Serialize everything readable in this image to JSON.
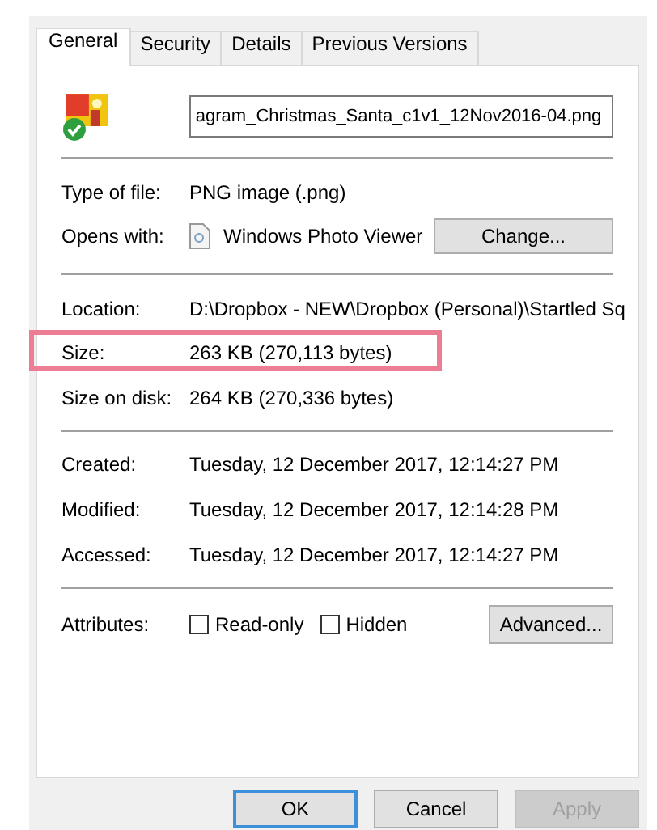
{
  "tabs": [
    {
      "label": "General",
      "selected": true
    },
    {
      "label": "Security",
      "selected": false
    },
    {
      "label": "Details",
      "selected": false
    },
    {
      "label": "Previous Versions",
      "selected": false
    }
  ],
  "file_name": "agram_Christmas_Santa_c1v1_12Nov2016-04.png",
  "type_of_file": {
    "label": "Type of file:",
    "value": "PNG image (.png)"
  },
  "opens_with": {
    "label": "Opens with:",
    "app": "Windows Photo Viewer",
    "button": "Change..."
  },
  "location_rows": [
    {
      "label": "Location:",
      "value": "D:\\Dropbox - NEW\\Dropbox (Personal)\\Startled Sq",
      "highlighted": false
    },
    {
      "label": "Size:",
      "value": "263 KB (270,113 bytes)",
      "highlighted": true
    },
    {
      "label": "Size on disk:",
      "value": "264 KB (270,336 bytes)",
      "highlighted": false
    }
  ],
  "date_rows": [
    {
      "label": "Created:",
      "value": "Tuesday, 12 December 2017, 12:14:27 PM"
    },
    {
      "label": "Modified:",
      "value": "Tuesday, 12 December 2017, 12:14:28 PM"
    },
    {
      "label": "Accessed:",
      "value": "Tuesday, 12 December 2017, 12:14:27 PM"
    }
  ],
  "attributes": {
    "label": "Attributes:",
    "checkboxes": [
      {
        "label": "Read-only",
        "checked": false
      },
      {
        "label": "Hidden",
        "checked": false
      }
    ],
    "button": "Advanced..."
  },
  "buttons": [
    {
      "label": "OK",
      "default": true,
      "disabled": false
    },
    {
      "label": "Cancel",
      "default": false,
      "disabled": false
    },
    {
      "label": "Apply",
      "default": false,
      "disabled": true
    }
  ]
}
